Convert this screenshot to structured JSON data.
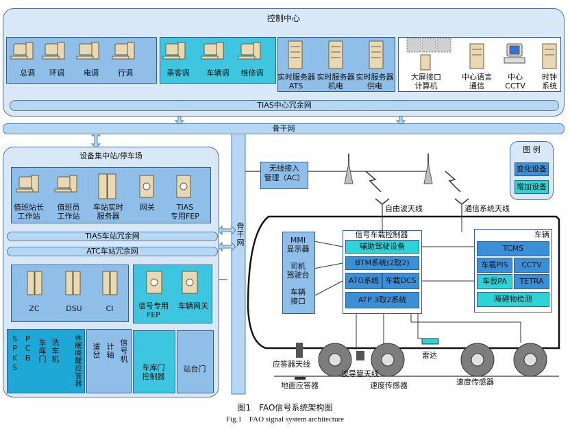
{
  "control_center": {
    "title": "控制中心",
    "dispatch_group": [
      "总调",
      "环调",
      "电调",
      "行调"
    ],
    "service_group": [
      "乘客调",
      "车辆调",
      "维修调"
    ],
    "servers": [
      [
        "实时服务器",
        "ATS"
      ],
      [
        "实时服务器",
        "机电"
      ],
      [
        "实时服务器",
        "供电"
      ]
    ],
    "external": [
      [
        "大屏接口",
        "计算机"
      ],
      [
        "中心语言",
        "通信"
      ],
      [
        "中心",
        "CCTV"
      ],
      [
        "时钟",
        "系统"
      ]
    ],
    "tias_bus": "TIAS中心冗余网"
  },
  "backbone_label": "骨干网",
  "backbone_vertical": "骨干网",
  "station": {
    "title": "设备集中站/停车场",
    "workstations": [
      [
        "值班站长",
        "工作站"
      ],
      [
        "值班员",
        "工作站"
      ],
      [
        "车站实时",
        "服务器"
      ],
      [
        "网关",
        ""
      ],
      [
        "TIAS",
        "专用FEP"
      ]
    ],
    "tias_bus": "TIAS车站冗余网",
    "atc_bus": "ATC车站冗余网",
    "atc_devices": [
      "ZC",
      "DSU",
      "CI"
    ],
    "fep_devices": [
      [
        "信号专用",
        "FEP"
      ],
      [
        "车辆网关",
        ""
      ]
    ],
    "field_left": [
      "SPKS",
      "PCB",
      "车库门",
      "洗车机",
      "休眠唤醒应答器"
    ],
    "field_mid": [
      "道岔",
      "计轴",
      "信号机"
    ],
    "depot_door": [
      "车库门",
      "控制器"
    ],
    "platform_door": "站台门"
  },
  "wireless": {
    "ac": [
      "无线接入",
      "管理（AC）"
    ],
    "free_wave_antenna": "自由波天线",
    "comm_antenna": "通信系统天线"
  },
  "legend": {
    "title": "图 例",
    "changed": "变化设备",
    "added": "增加设备",
    "changed_color": "#3a8fd6",
    "added_color": "#2ed3d8"
  },
  "train": {
    "mmi": [
      "MMI",
      "显示器"
    ],
    "driver_desk": [
      "司机",
      "驾驶台"
    ],
    "vehicle_interface": [
      "车辆",
      "接口"
    ],
    "obc_title": "信号车载控制器",
    "obc_items": {
      "ado": "辅助驾驶设备",
      "btm": "BTM系统(2取2)",
      "ato": "ATO系统",
      "dcs": "车载DCS",
      "atp": "ATP 3取2系统"
    },
    "vehicle_title": "车辆",
    "vehicle_items": {
      "tcms": "TCMS",
      "pis": "车载PIS",
      "cctv": "CCTV",
      "pa": "车载PA",
      "tetra": "TETRA",
      "obstacle": "障碍物检测"
    },
    "transponder_antenna": "应答器天线",
    "ground_transponder": "地面应答器",
    "waveguide_antenna": "波导管天线",
    "speed_sensor_left": "速度传感器",
    "radar": "雷达",
    "speed_sensor_right": "速度传感器"
  },
  "caption": {
    "cn": "图1　FAO信号系统架构图",
    "en": "Fig.1　FAO signal system architecture"
  }
}
